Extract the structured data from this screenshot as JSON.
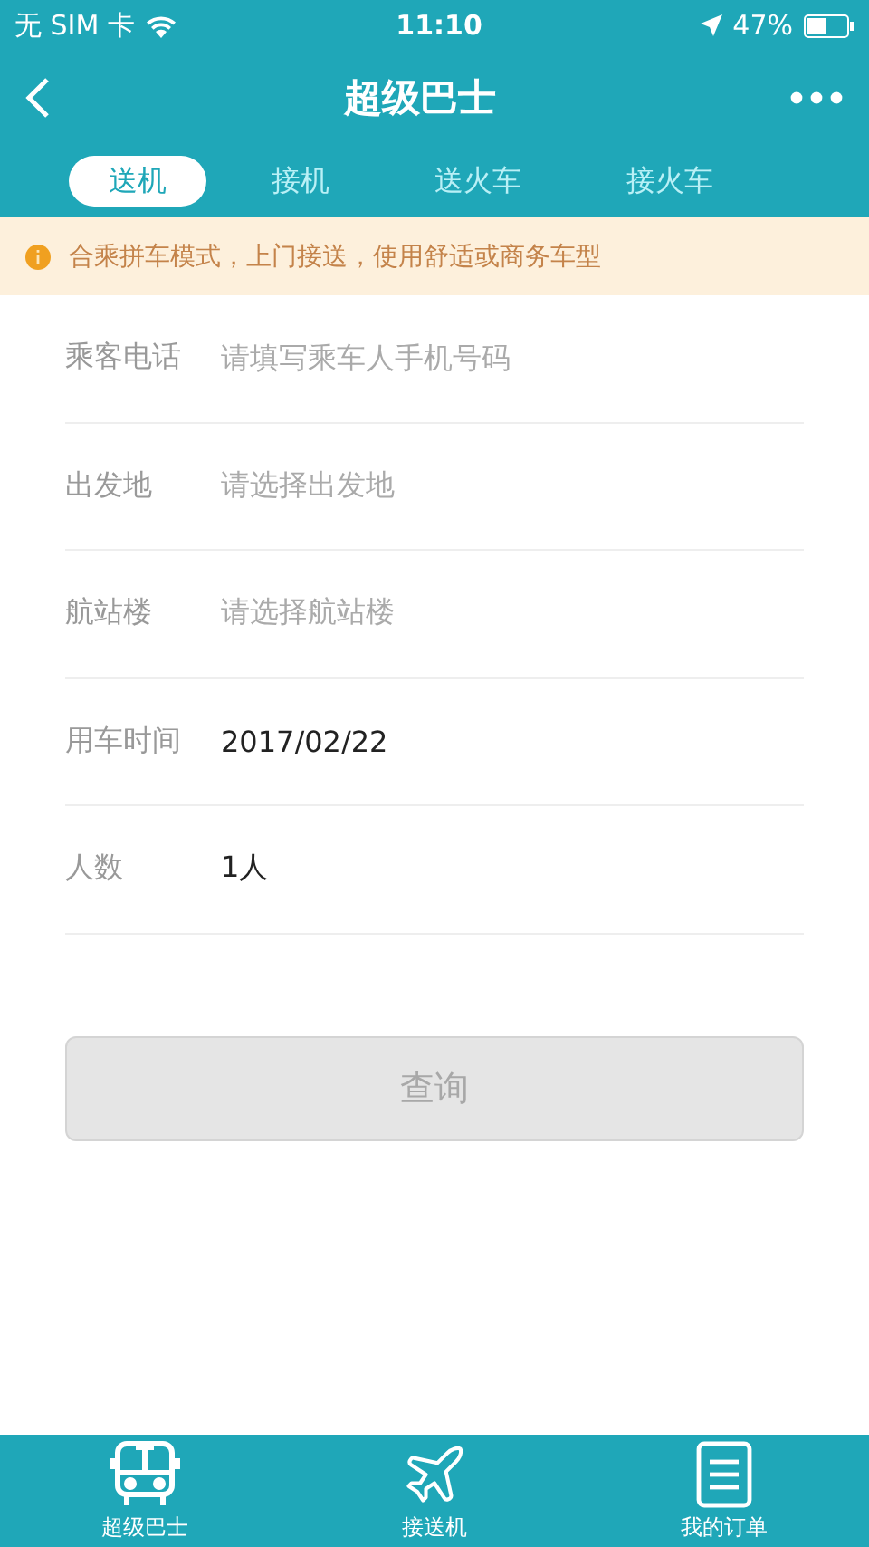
{
  "status_bar": {
    "carrier": "无 SIM 卡",
    "time": "11:10",
    "battery": "47%"
  },
  "header": {
    "title": "超级巴士"
  },
  "tabs": [
    {
      "label": "送机",
      "selected": true
    },
    {
      "label": "接机",
      "selected": false
    },
    {
      "label": "送火车",
      "selected": false
    },
    {
      "label": "接火车",
      "selected": false
    }
  ],
  "notice": {
    "text": "合乘拼车模式，上门接送，使用舒适或商务车型"
  },
  "form": [
    {
      "kind": "input",
      "label": "乘客电话",
      "placeholder": "请填写乘车人手机号码"
    },
    {
      "kind": "select",
      "label": "出发地",
      "placeholder": "请选择出发地"
    },
    {
      "kind": "select",
      "label": "航站楼",
      "placeholder": "请选择航站楼"
    },
    {
      "kind": "select",
      "label": "用车时间",
      "value": "2017/02/22"
    },
    {
      "kind": "select",
      "label": "人数",
      "value": "1人"
    }
  ],
  "submit": {
    "label": "查询",
    "disabled": true
  },
  "bottom_nav": [
    {
      "kind": "bus",
      "label": "超级巴士"
    },
    {
      "kind": "plane",
      "label": "接送机"
    },
    {
      "kind": "orders",
      "label": "我的订单"
    }
  ]
}
